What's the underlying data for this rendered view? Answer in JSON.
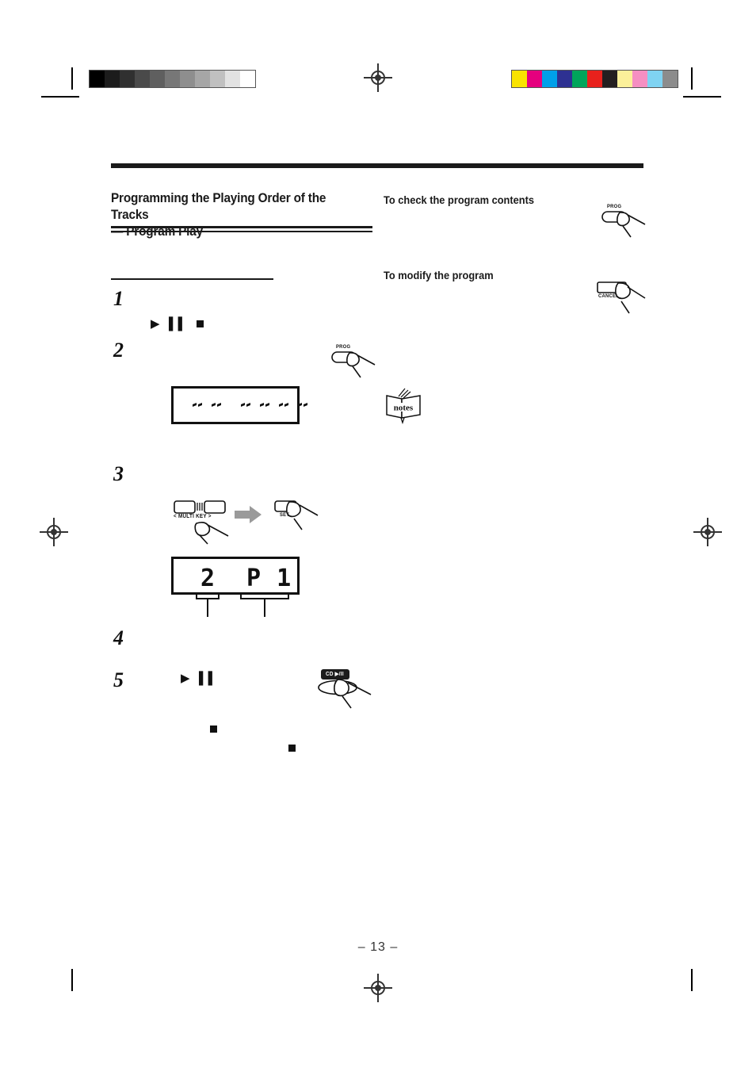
{
  "document": {
    "page_number": "– 13 –"
  },
  "print_marks": {
    "grayscale_swatches": [
      "#000000",
      "#1c1c1c",
      "#303030",
      "#4a4a4a",
      "#5f5f5f",
      "#777777",
      "#8e8e8e",
      "#a6a6a6",
      "#c0c0c0",
      "#e2e2e2",
      "#ffffff"
    ],
    "color_swatches": [
      "#f9e300",
      "#e5007e",
      "#00a0e9",
      "#2e3192",
      "#00a55b",
      "#e8211c",
      "#231f20",
      "#fbf09a",
      "#f58fc2",
      "#7fd3f2",
      "#8c8c8c"
    ],
    "registration_mark_name": "registration-target"
  },
  "section": {
    "title_line1": "Programming the Playing Order of the Tracks",
    "title_line2": "— Program Play"
  },
  "steps": [
    {
      "number": "1"
    },
    {
      "number": "2"
    },
    {
      "number": "3"
    },
    {
      "number": "4"
    },
    {
      "number": "5"
    }
  ],
  "symbols": {
    "play_pause": "▶ ▐▐",
    "play": "▶",
    "pause": "▐▐",
    "stop": "■"
  },
  "right_column": {
    "check_heading": "To check the program contents",
    "modify_heading": "To modify the program",
    "notes_icon_label": "notes"
  },
  "buttons": {
    "prog": "PROG",
    "cancel": "CANCEL",
    "multi_key": "< MULTI KEY >",
    "set": "SET",
    "cd_play_pause": "CD ▶/II"
  },
  "display_step2": {
    "segments": [
      "--",
      "--",
      "--",
      "--",
      "--",
      "--"
    ]
  },
  "display_step3": {
    "track_number": "2",
    "program_indicator": "P 1"
  }
}
